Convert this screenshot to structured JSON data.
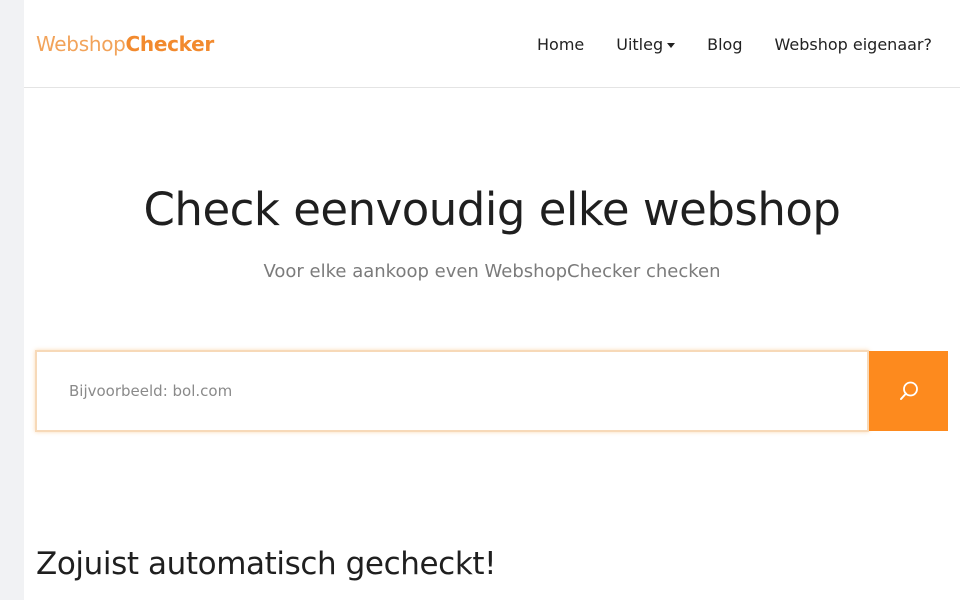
{
  "brand": {
    "logo_light": "Websh",
    "logo_o": "o",
    "logo_p": "p",
    "logo_bold": "Checker",
    "colors": {
      "accent": "#fd8a1e",
      "logo_light": "#f2a35a",
      "logo_bold": "#f28a2e"
    }
  },
  "nav": {
    "items": [
      {
        "label": "Home"
      },
      {
        "label": "Uitleg",
        "icon": "caret-down-icon"
      },
      {
        "label": "Blog"
      },
      {
        "label": "Webshop eigenaar?"
      }
    ]
  },
  "hero": {
    "title": "Check eenvoudig elke webshop",
    "subtitle": "Voor elke aankoop even WebshopChecker checken"
  },
  "search": {
    "placeholder": "Bijvoorbeeld: bol.com",
    "value": "",
    "button_icon": "search-icon"
  },
  "section": {
    "title": "Zojuist automatisch gecheckt!"
  }
}
